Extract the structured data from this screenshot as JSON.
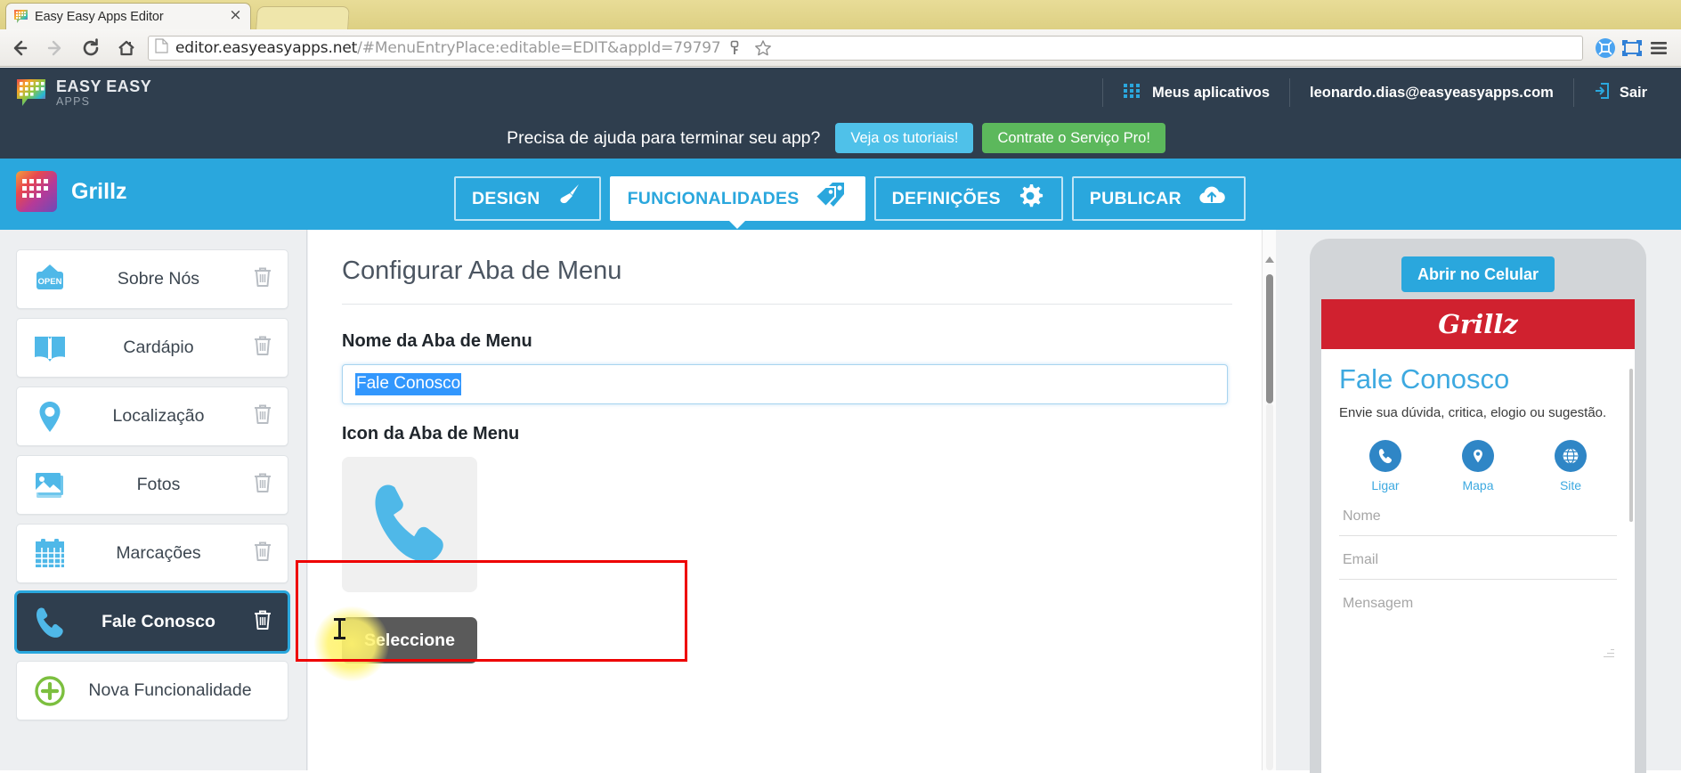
{
  "browser": {
    "tab_title": "Easy Easy Apps Editor",
    "tab_favicon": "easyeasyapps-favicon-icon",
    "close_label": "×",
    "back_icon": "back-arrow-icon",
    "forward_icon": "forward-arrow-icon",
    "reload_icon": "reload-icon",
    "home_icon": "home-icon",
    "page_icon": "page-document-icon",
    "url_domain": "editor.easyeasyapps.net",
    "url_path": "/#MenuEntryPlace:editable=EDIT&appId=79797",
    "url_full": "editor.easyeasyapps.net/#MenuEntryPlace:editable=EDIT&appId=79797",
    "toolbar_icons": [
      "key-icon",
      "star-bookmark-icon",
      "extension-blue-icon",
      "screen-capture-icon",
      "hamburger-menu-icon"
    ]
  },
  "header": {
    "brand_name": "EASY EASY",
    "brand_sub": "APPS",
    "apps_label": "Meus aplicativos",
    "apps_icon": "grid-apps-icon",
    "user_email": "leonardo.dias@easyeasyapps.com",
    "logout_icon": "logout-icon",
    "logout_label": "Sair"
  },
  "promo": {
    "text": "Precisa de ajuda para terminar seu app?",
    "tutorials_label": "Veja os tutoriais!",
    "pro_label": "Contrate o Serviço Pro!",
    "tutorials_color": "#4fc1e9",
    "pro_color": "#5cb85c"
  },
  "appnav": {
    "app_name": "Grillz",
    "app_icon": "app-thumbnail-icon",
    "tabs": [
      {
        "label": "DESIGN",
        "icon": "paintbrush-icon",
        "active": false
      },
      {
        "label": "FUNCIONALIDADES",
        "icon": "tags-icon",
        "active": true
      },
      {
        "label": "DEFINIÇÕES",
        "icon": "gear-icon",
        "active": false
      },
      {
        "label": "PUBLICAR",
        "icon": "cloud-upload-icon",
        "active": false
      }
    ],
    "bar_color": "#2aa7dd"
  },
  "sidebar": {
    "items": [
      {
        "label": "Sobre Nós",
        "icon": "open-sign-icon",
        "selected": false
      },
      {
        "label": "Cardápio",
        "icon": "open-book-icon",
        "selected": false
      },
      {
        "label": "Localização",
        "icon": "map-pin-icon",
        "selected": false
      },
      {
        "label": "Fotos",
        "icon": "photos-stack-icon",
        "selected": false
      },
      {
        "label": "Marcações",
        "icon": "calendar-icon",
        "selected": false
      },
      {
        "label": "Fale Conosco",
        "icon": "phone-handset-icon",
        "selected": true
      }
    ],
    "delete_icon": "trash-icon",
    "add_label": "Nova Funcionalidade",
    "add_icon": "plus-circle-icon"
  },
  "main": {
    "title": "Configurar Aba de Menu",
    "name_label": "Nome da Aba de Menu",
    "name_value": "Fale Conosco",
    "icon_label": "Icon da Aba de Menu",
    "icon_preview": "phone-handset-icon",
    "select_button": "Seleccione",
    "annotation_color": "#ee0000",
    "selection_color": "#3297fd"
  },
  "preview": {
    "open_mobile_label": "Abrir no Celular",
    "brand_logo": "Grillz",
    "brand_bar_color": "#d0212f",
    "screen_title": "Fale Conosco",
    "screen_desc": "Envie sua dúvida, critica, elogio ou sugestão.",
    "actions": [
      {
        "label": "Ligar",
        "icon": "phone-icon"
      },
      {
        "label": "Mapa",
        "icon": "map-pin-icon"
      },
      {
        "label": "Site",
        "icon": "globe-icon"
      }
    ],
    "fields": [
      {
        "placeholder": "Nome"
      },
      {
        "placeholder": "Email"
      }
    ],
    "message_placeholder": "Mensagem"
  }
}
